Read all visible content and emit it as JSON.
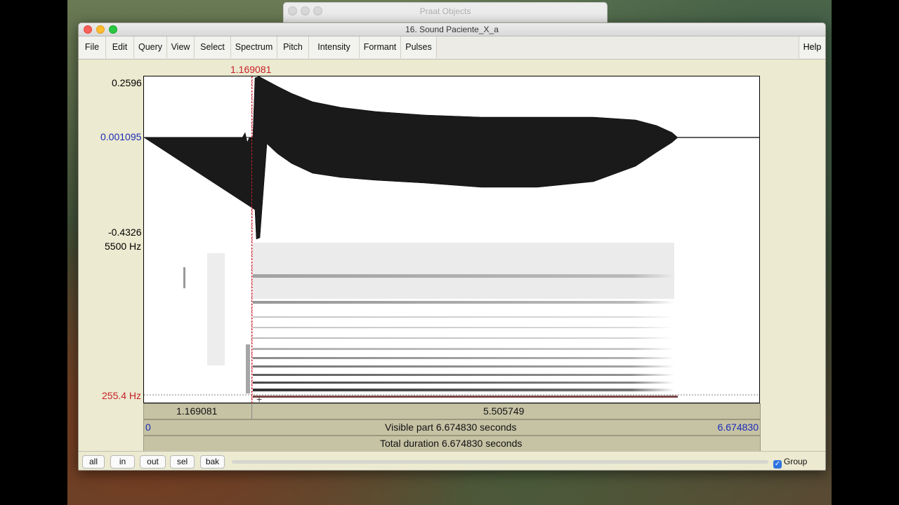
{
  "background_window": {
    "title": "Praat Objects"
  },
  "window": {
    "title": "16. Sound Paciente_X_a"
  },
  "menu": {
    "items": [
      "File",
      "Edit",
      "Query",
      "View",
      "Select",
      "Spectrum",
      "Pitch",
      "Intensity",
      "Formant",
      "Pulses"
    ],
    "help": "Help"
  },
  "waveform": {
    "cursor_time": "1.169081",
    "y_max": "0.2596",
    "y_zero": "0.001095",
    "y_min": "-0.4326"
  },
  "spectrogram": {
    "freq_top": "5500 Hz",
    "freq_cursor": "255.4 Hz"
  },
  "time_bars": {
    "left_segment": "1.169081",
    "right_segment": "5.505749",
    "visible_start": "0",
    "visible_label": "Visible part 6.674830 seconds",
    "visible_end": "6.674830",
    "total_label": "Total duration 6.674830 seconds"
  },
  "bottom": {
    "buttons": [
      "all",
      "in",
      "out",
      "sel",
      "bak"
    ],
    "group_label": "Group",
    "group_checked": true
  },
  "colors": {
    "cursor_red": "#c8202a",
    "axis_blue": "#1a2ab8",
    "bar_tan": "#c6c3a5"
  }
}
